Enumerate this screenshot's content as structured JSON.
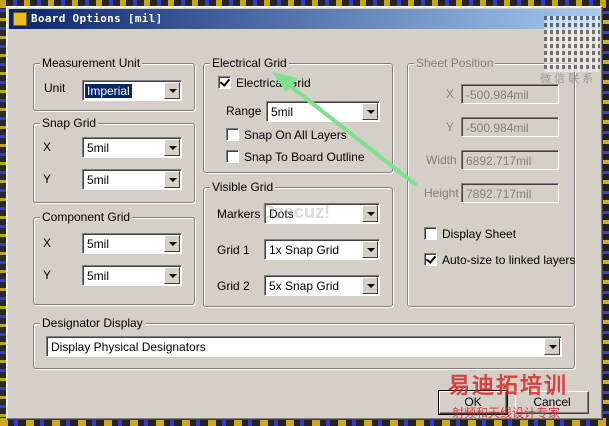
{
  "window": {
    "title": "Board Options [mil]"
  },
  "measurement_unit": {
    "legend": "Measurement Unit",
    "unit_label": "Unit",
    "unit_value": "Imperial"
  },
  "snap_grid": {
    "legend": "Snap Grid",
    "x_label": "X",
    "x_value": "5mil",
    "y_label": "Y",
    "y_value": "5mil"
  },
  "component_grid": {
    "legend": "Component Grid",
    "x_label": "X",
    "x_value": "5mil",
    "y_label": "Y",
    "y_value": "5mil"
  },
  "electrical_grid": {
    "legend": "Electrical Grid",
    "enable_label": "Electrical Grid",
    "enable_checked": true,
    "range_label": "Range",
    "range_value": "5mil",
    "snap_on_all_layers_label": "Snap On All Layers",
    "snap_on_all_layers_checked": false,
    "snap_to_board_outline_label": "Snap To Board Outline",
    "snap_to_board_outline_checked": false
  },
  "visible_grid": {
    "legend": "Visible Grid",
    "markers_label": "Markers",
    "markers_value": "Dots",
    "grid1_label": "Grid 1",
    "grid1_value": "1x Snap Grid",
    "grid2_label": "Grid 2",
    "grid2_value": "5x Snap Grid"
  },
  "sheet_position": {
    "legend": "Sheet Position",
    "x_label": "X",
    "x_value": "-500.984mil",
    "y_label": "Y",
    "y_value": "-500.984mil",
    "width_label": "Width",
    "width_value": "6892.717mil",
    "height_label": "Height",
    "height_value": "7892.717mil",
    "display_sheet_label": "Display Sheet",
    "display_sheet_checked": false,
    "auto_size_label": "Auto-size to linked layers",
    "auto_size_checked": true
  },
  "designator_display": {
    "legend": "Designator Display",
    "value": "Display Physical Designators"
  },
  "buttons": {
    "ok": "OK",
    "cancel": "Cancel"
  },
  "overlays": {
    "watermark": "Dzscuz!",
    "brand_name": "易迪拓培训",
    "brand_sub": "射频和天线设计专家",
    "qr_caption": "微 信 联 系"
  },
  "colors": {
    "annotation_arrow": "#7ee08a",
    "title_bar": "#0a246a"
  }
}
